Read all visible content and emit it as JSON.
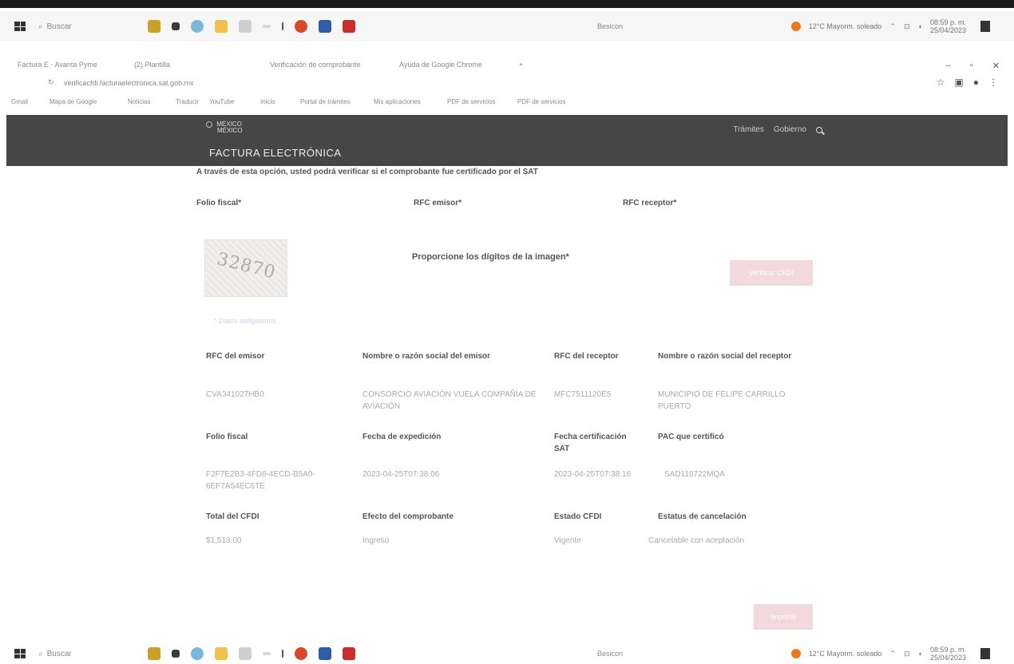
{
  "taskbar": {
    "search_placeholder": "Buscar",
    "center_label": "Besicon",
    "weather": "12°C Mayorm. soleado",
    "clock_time": "08:59 p. m.",
    "clock_date": "25/04/2023"
  },
  "browser": {
    "tabs": [
      "Factura E - Avanta Pyme",
      "(2) Plantilla",
      "Verificación de comprobante",
      "Ayuda de Google Chrome"
    ],
    "url": "verificacfdi.facturaelectronica.sat.gob.mx",
    "bookmarks": [
      "Gmail",
      "Mapa de Google",
      "Noticias",
      "Traducir",
      "YouTube",
      "Inicio",
      "Portal de trámites",
      "Mis aplicaciones",
      "PDF de servicios",
      "PDF de servicios"
    ]
  },
  "site": {
    "logo_line1": "MÉXICO",
    "logo_line2": "MÉXICO",
    "nav_tramites": "Trámites",
    "nav_gobierno": "Gobierno",
    "page_title": "FACTURA ELECTRÓNICA"
  },
  "form": {
    "intro": "A través de esta opción, usted podrá verificar si el comprobante fue certificado por el SAT",
    "folio_label": "Folio fiscal*",
    "rfc_emisor_label": "RFC emisor*",
    "rfc_receptor_label": "RFC receptor*",
    "captcha_text": "32870",
    "captcha_prompt": "Proporcione los dígitos de la imagen*",
    "verify_button": "Verificar CFDI",
    "captcha_link": "* Datos obligatorios"
  },
  "result": {
    "rows": [
      {
        "headers": [
          "RFC del emisor",
          "Nombre o razón social del emisor",
          "RFC del receptor",
          "Nombre o razón social del receptor"
        ],
        "values": [
          "CVA341027HB0",
          "CONSORCIO AVIACIÓN VUELA COMPAÑÍA DE AVIACIÓN",
          "MFC7511120E5",
          "MUNICIPIO DE FELIPE CARRILLO PUERTO"
        ]
      },
      {
        "headers": [
          "Folio fiscal",
          "Fecha de expedición",
          "Fecha certificación SAT",
          "PAC que certificó"
        ],
        "values": [
          "F2F7E2B3-4FD8-4ECD-B5A0-6EF7A54EC6TE",
          "2023-04-25T07:38:06",
          "2023-04-25T07:38:16",
          "SAD110722MQA"
        ]
      },
      {
        "headers": [
          "Total del CFDI",
          "Efecto del comprobante",
          "Estado CFDI",
          "Estatus de cancelación"
        ],
        "values": [
          "$1,513.00",
          "Ingreso",
          "Vigente",
          "Cancelable con aceptación"
        ]
      }
    ],
    "print_button": "Imprimir"
  }
}
